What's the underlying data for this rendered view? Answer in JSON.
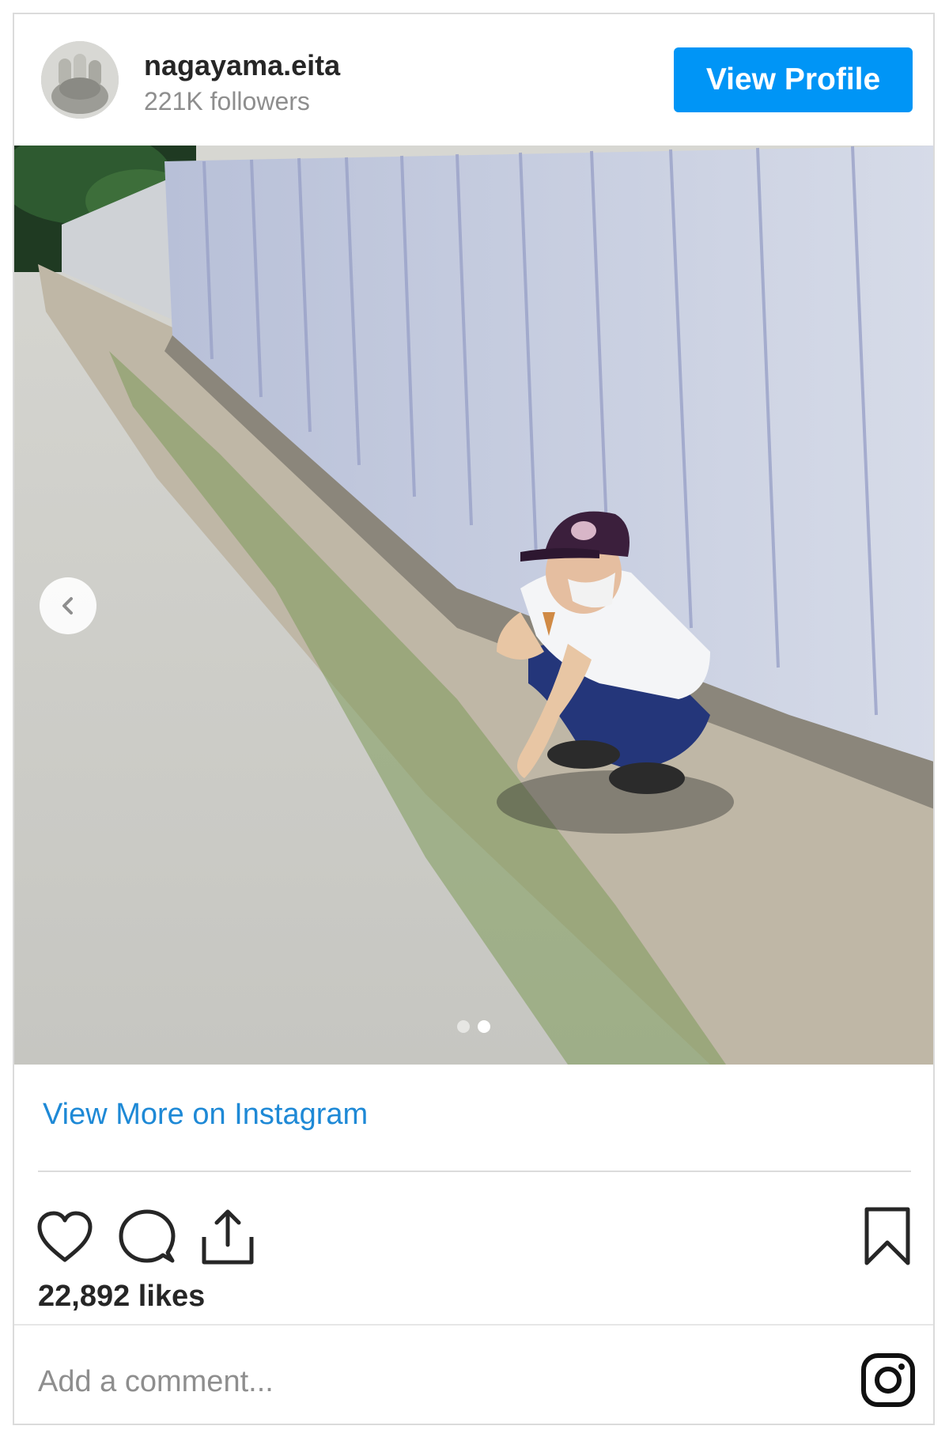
{
  "profile": {
    "username": "nagayama.eita",
    "followers": "221K followers",
    "view_profile_label": "View Profile"
  },
  "post": {
    "carousel_count": 2,
    "carousel_active_index": 1
  },
  "view_more_label": "View More on Instagram",
  "likes": "22,892 likes",
  "comment_placeholder": "Add a comment...",
  "colors": {
    "accent": "#0095f6",
    "link": "#1e89d6",
    "text": "#262626",
    "muted": "#8e8e8e"
  },
  "icons": [
    "heart-icon",
    "comment-icon",
    "share-icon",
    "bookmark-icon",
    "instagram-icon",
    "chevron-left-icon"
  ]
}
